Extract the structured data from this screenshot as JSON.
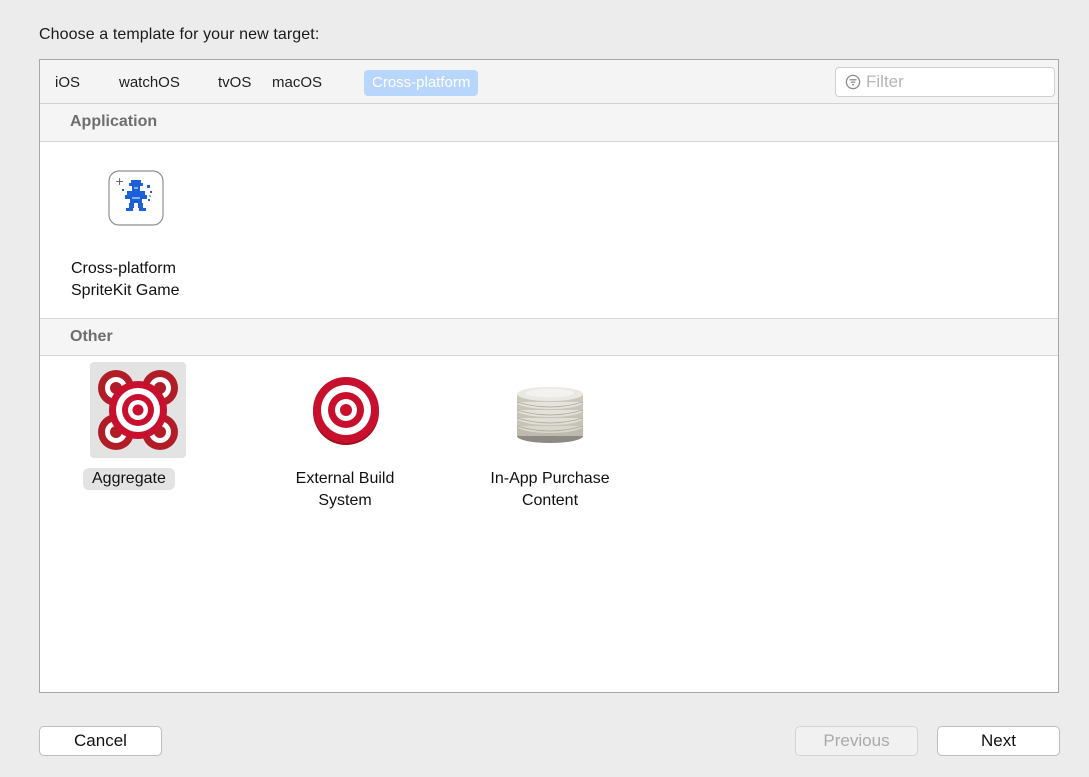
{
  "dialog": {
    "heading": "Choose a template for your new target:"
  },
  "tabs": [
    {
      "label": "iOS",
      "selected": false
    },
    {
      "label": "watchOS",
      "selected": false
    },
    {
      "label": "tvOS",
      "selected": false
    },
    {
      "label": "macOS",
      "selected": false
    },
    {
      "label": "Cross-platform",
      "selected": true
    }
  ],
  "filter": {
    "placeholder": "Filter",
    "value": "",
    "icon": "filter-icon"
  },
  "sections": [
    {
      "title": "Application",
      "templates": [
        {
          "label_line1": "Cross-platform",
          "label_line2": "SpriteKit Game",
          "icon": "spritekit-game-icon",
          "selected": false
        }
      ]
    },
    {
      "title": "Other",
      "templates": [
        {
          "label_line1": "Aggregate",
          "label_line2": "",
          "icon": "aggregate-target-icon",
          "selected": true
        },
        {
          "label_line1": "External Build",
          "label_line2": "System",
          "icon": "target-icon",
          "selected": false
        },
        {
          "label_line1": "In-App Purchase",
          "label_line2": "Content",
          "icon": "coins-stack-icon",
          "selected": false
        }
      ]
    }
  ],
  "buttons": {
    "cancel": "Cancel",
    "previous": "Previous",
    "next": "Next",
    "previous_enabled": false
  },
  "colors": {
    "selected_tab_bg": "#b8d6fb",
    "target_red": "#c8102e",
    "selection_gray": "#e3e3e3"
  }
}
